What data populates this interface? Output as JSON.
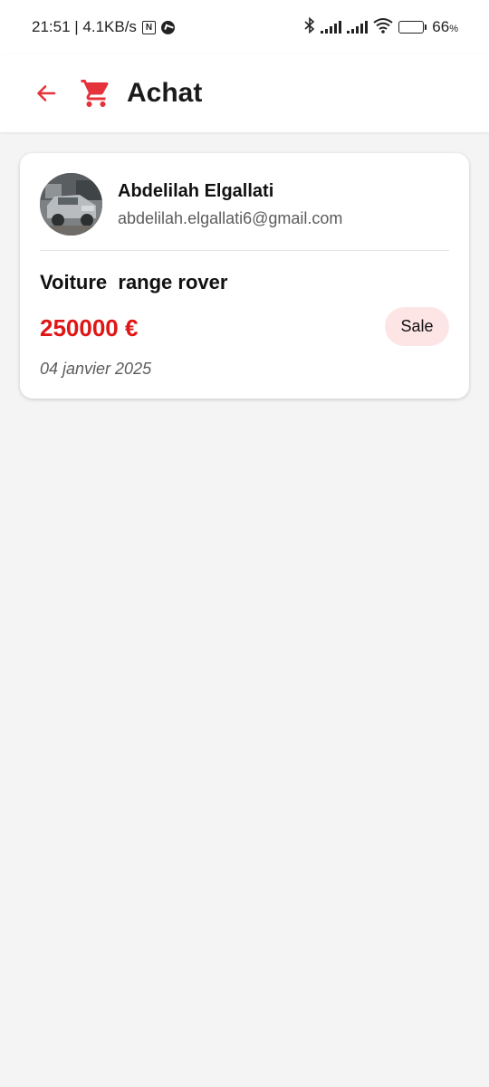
{
  "status_bar": {
    "time_speed": "21:51 | 4.1KB/s",
    "nfc_label": "N",
    "battery_percent": "66",
    "battery_percent_sign": "%",
    "battery_level": 0.66,
    "icons": [
      "nfc-icon",
      "app-notification-icon",
      "bluetooth-icon",
      "signal-icon",
      "signal-icon",
      "wifi-icon",
      "battery-icon"
    ]
  },
  "app_bar": {
    "title": "Achat",
    "back_icon": "arrow-left-icon",
    "title_icon": "shopping-cart-icon",
    "accent_color": "#e5333b"
  },
  "purchases": [
    {
      "user_name": "Abdelilah Elgallati",
      "user_email": "abdelilah.elgallati6@gmail.com",
      "item_title": "Voiture  range rover",
      "price": "250000 €",
      "status": "Sale",
      "date": "04 janvier 2025"
    }
  ],
  "colors": {
    "price": "#e01616",
    "badge_bg": "#fde5e5",
    "background": "#f4f4f4"
  }
}
